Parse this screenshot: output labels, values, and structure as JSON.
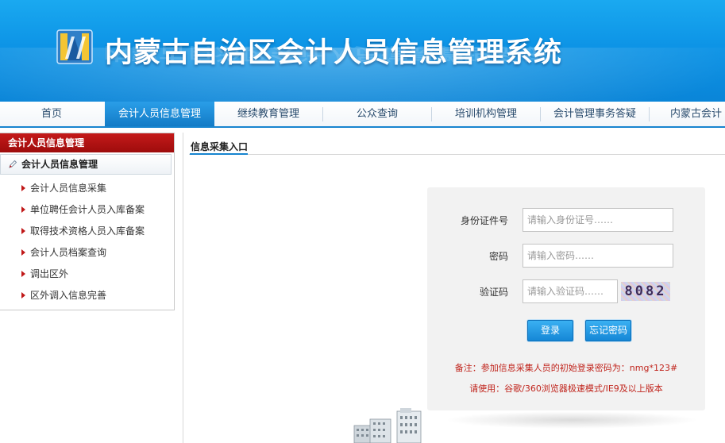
{
  "header": {
    "title": "内蒙古自治区会计人员信息管理系统",
    "logo_icon": "nmg-logo-icon"
  },
  "nav": {
    "items": [
      {
        "label": "首页",
        "active": false
      },
      {
        "label": "会计人员信息管理",
        "active": true
      },
      {
        "label": "继续教育管理",
        "active": false
      },
      {
        "label": "公众查询",
        "active": false
      },
      {
        "label": "培训机构管理",
        "active": false
      },
      {
        "label": "会计管理事务答疑",
        "active": false
      },
      {
        "label": "内蒙古会计",
        "active": false
      }
    ]
  },
  "sidebar": {
    "header": "会计人员信息管理",
    "group": "会计人员信息管理",
    "items": [
      {
        "label": "会计人员信息采集"
      },
      {
        "label": "单位聘任会计人员入库备案"
      },
      {
        "label": "取得技术资格人员入库备案"
      },
      {
        "label": "会计人员档案查询"
      },
      {
        "label": "调出区外"
      },
      {
        "label": "区外调入信息完善"
      }
    ]
  },
  "content": {
    "tab_label": "信息采集入口"
  },
  "login": {
    "id_label": "身份证件号",
    "id_placeholder": "请输入身份证号……",
    "password_label": "密码",
    "password_placeholder": "请输入密码……",
    "captcha_label": "验证码",
    "captcha_placeholder": "请输入验证码……",
    "captcha_text": "8082",
    "login_button": "登录",
    "forgot_button": "忘记密码",
    "note1": "备注：参加信息采集人员的初始登录密码为：nmg*123#",
    "note2": "请使用：谷歌/360浏览器极速模式/IE9及以上版本"
  },
  "colors": {
    "banner": "#0d94e6",
    "nav_active": "#1684cf",
    "sidebar_header": "#b01212",
    "note_text": "#c0241c"
  }
}
